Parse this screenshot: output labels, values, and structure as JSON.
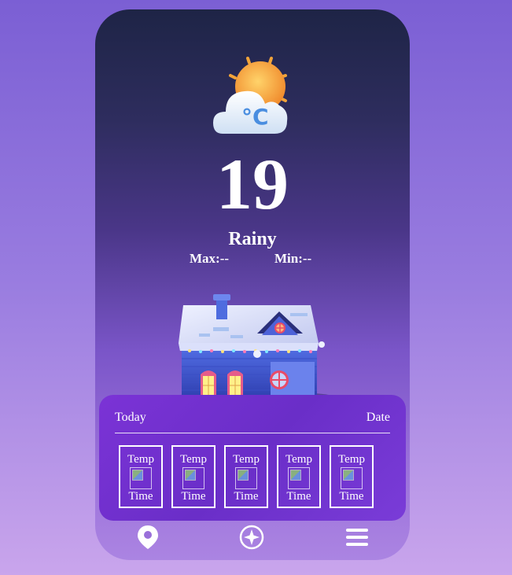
{
  "weather": {
    "icon": "sun-cloud-celsius-icon",
    "temperature": "19",
    "condition": "Rainy",
    "max_label": "Max:--",
    "min_label": "Min:--"
  },
  "scene": {
    "icon": "snowy-house-illustration"
  },
  "forecast": {
    "today_label": "Today",
    "date_label": "Date",
    "items": [
      {
        "temp": "Temp",
        "time": "Time"
      },
      {
        "temp": "Temp",
        "time": "Time"
      },
      {
        "temp": "Temp",
        "time": "Time"
      },
      {
        "temp": "Temp",
        "time": "Time"
      },
      {
        "temp": "Temp",
        "time": "Time"
      }
    ]
  },
  "nav": {
    "items": [
      {
        "icon": "location-pin-icon"
      },
      {
        "icon": "compass-star-icon"
      },
      {
        "icon": "menu-icon"
      }
    ]
  },
  "colors": {
    "background": "#8a6bd9",
    "phone_top": "#1e2446",
    "phone_bottom": "#ab84e2",
    "forecast_panel": "#7033d0",
    "text": "#ffffff"
  }
}
